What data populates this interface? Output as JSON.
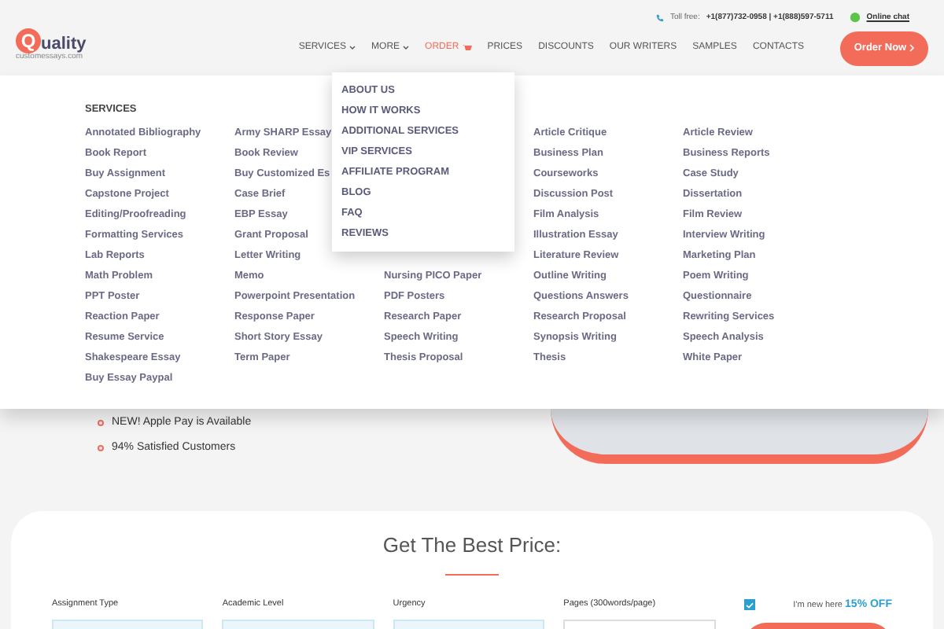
{
  "header": {
    "logo_letter": "Q",
    "logo_text": "uality",
    "logo_sub": "customessays.com",
    "toll_free_label": "Toll free:",
    "phones": "+1(877)732-0958 | +1(888)597-5711",
    "online_chat": "Online chat",
    "nav": [
      {
        "label": "SERVICES",
        "kind": "dropdown"
      },
      {
        "label": "MORE",
        "kind": "dropdown"
      },
      {
        "label": "ORDER",
        "kind": "cart"
      },
      {
        "label": "PRICES",
        "kind": "plain"
      },
      {
        "label": "DISCOUNTS",
        "kind": "plain"
      },
      {
        "label": "OUR WRITERS",
        "kind": "plain"
      },
      {
        "label": "SAMPLES",
        "kind": "plain"
      },
      {
        "label": "CONTACTS",
        "kind": "plain"
      }
    ],
    "order_button": "Order Now"
  },
  "mega_menu": {
    "heading": "SERVICES",
    "columns": [
      [
        "Annotated Bibliography",
        "Book Report",
        "Buy Assignment",
        "Capstone Project",
        "Editing/Proofreading",
        "Formatting Services",
        "Lab Reports",
        "Math Problem",
        "PPT Poster",
        "Reaction Paper",
        "Resume Service",
        "Shakespeare Essay",
        "Buy Essay Paypal"
      ],
      [
        "Army SHARP Essay",
        "Book Review",
        "Buy Customized Es",
        "Case Brief",
        "EBP Essay",
        "Grant Proposal",
        "Letter Writing",
        "Memo",
        "Powerpoint Presentation",
        "Response Paper",
        "Short Story Essay",
        "Term Paper"
      ],
      [
        "Nursing PICO Paper",
        "PDF Posters",
        "Research Paper",
        "Speech Writing",
        "Thesis Proposal"
      ],
      [
        "Article Critique",
        "Business Plan",
        "Courseworks",
        "Discussion Post",
        "Film Analysis",
        "Illustration Essay",
        "Literature Review",
        "Outline Writing",
        "Questions Answers",
        "Research Proposal",
        "Synopsis Writing",
        "Thesis"
      ],
      [
        "Article Review",
        "Business Reports",
        "Case Study",
        "Dissertation",
        "Film Review",
        "Interview Writing",
        "Marketing Plan",
        "Poem Writing",
        "Questionnaire",
        "Rewriting Services",
        "Speech Analysis",
        "White Paper"
      ]
    ]
  },
  "more_dropdown": [
    "ABOUT US",
    "HOW IT WORKS",
    "ADDITIONAL SERVICES",
    "VIP SERVICES",
    "AFFILIATE PROGRAM",
    "BLOG",
    "FAQ",
    "REVIEWS"
  ],
  "hero": {
    "bullets": [
      "NEW! Apple Pay is Available",
      "94% Satisfied Customers"
    ]
  },
  "price_form": {
    "title": "Get The Best Price:",
    "fields": [
      {
        "label": "Assignment Type",
        "kind": "select"
      },
      {
        "label": "Academic Level",
        "kind": "select"
      },
      {
        "label": "Urgency",
        "kind": "select"
      },
      {
        "label": "Pages (300words/page)",
        "kind": "stepper"
      }
    ],
    "new_customer": {
      "checked": true,
      "label": "I'm new here",
      "discount": "15% OFF"
    }
  }
}
